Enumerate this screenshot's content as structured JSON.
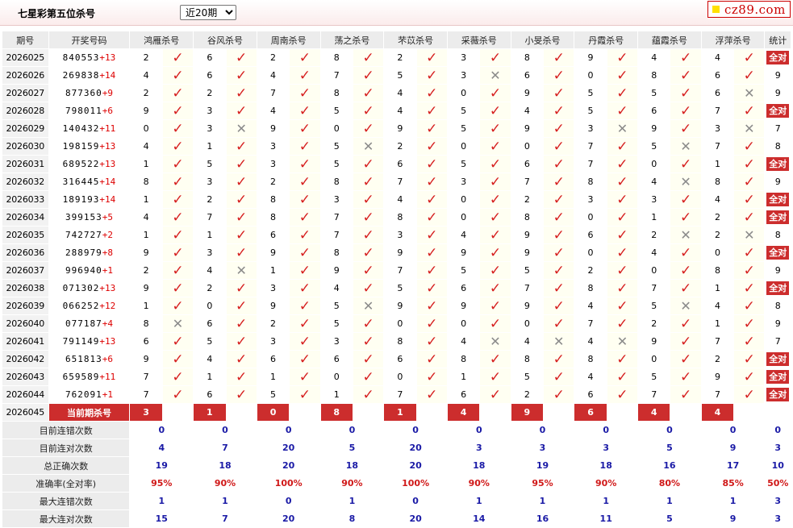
{
  "header": {
    "title": "七星彩第五位杀号",
    "period_options": [
      "近20期"
    ],
    "period_selected": "近20期",
    "logo_text": "cz89.com"
  },
  "table": {
    "col_period": "期号",
    "col_nums": "开奖号码",
    "col_stat": "统计",
    "experts": [
      "鸿雁杀号",
      "谷风杀号",
      "周南杀号",
      "荡之杀号",
      "芣苡杀号",
      "采薇杀号",
      "小旻杀号",
      "丹霞杀号",
      "蕴霞杀号",
      "浮萍杀号"
    ],
    "rows": [
      {
        "period": "2026025",
        "nums": "840553",
        "sum": "+13",
        "kills": [
          "2",
          "6",
          "2",
          "8",
          "2",
          "3",
          "8",
          "9",
          "4",
          "4"
        ],
        "ok": [
          1,
          1,
          1,
          1,
          1,
          1,
          1,
          1,
          1,
          1
        ],
        "stat": "全对"
      },
      {
        "period": "2026026",
        "nums": "269838",
        "sum": "+14",
        "kills": [
          "4",
          "6",
          "4",
          "7",
          "5",
          "3",
          "6",
          "0",
          "8",
          "6"
        ],
        "ok": [
          1,
          1,
          1,
          1,
          1,
          0,
          1,
          1,
          1,
          1
        ],
        "stat": "9"
      },
      {
        "period": "2026027",
        "nums": "877360",
        "sum": "+9",
        "kills": [
          "2",
          "2",
          "7",
          "8",
          "4",
          "0",
          "9",
          "5",
          "5",
          "6"
        ],
        "ok": [
          1,
          1,
          1,
          1,
          1,
          1,
          1,
          1,
          1,
          0
        ],
        "stat": "9"
      },
      {
        "period": "2026028",
        "nums": "798011",
        "sum": "+6",
        "kills": [
          "9",
          "3",
          "4",
          "5",
          "4",
          "5",
          "4",
          "5",
          "6",
          "7"
        ],
        "ok": [
          1,
          1,
          1,
          1,
          1,
          1,
          1,
          1,
          1,
          1
        ],
        "stat": "全对"
      },
      {
        "period": "2026029",
        "nums": "140432",
        "sum": "+11",
        "kills": [
          "0",
          "3",
          "9",
          "0",
          "9",
          "5",
          "9",
          "3",
          "9",
          "3"
        ],
        "ok": [
          1,
          0,
          1,
          1,
          1,
          1,
          1,
          0,
          1,
          0
        ],
        "stat": "7"
      },
      {
        "period": "2026030",
        "nums": "198159",
        "sum": "+13",
        "kills": [
          "4",
          "1",
          "3",
          "5",
          "2",
          "0",
          "0",
          "7",
          "5",
          "7"
        ],
        "ok": [
          1,
          1,
          1,
          0,
          1,
          1,
          1,
          1,
          0,
          1
        ],
        "stat": "8"
      },
      {
        "period": "2026031",
        "nums": "689522",
        "sum": "+13",
        "kills": [
          "1",
          "5",
          "3",
          "5",
          "6",
          "5",
          "6",
          "7",
          "0",
          "1"
        ],
        "ok": [
          1,
          1,
          1,
          1,
          1,
          1,
          1,
          1,
          1,
          1
        ],
        "stat": "全对"
      },
      {
        "period": "2026032",
        "nums": "316445",
        "sum": "+14",
        "kills": [
          "8",
          "3",
          "2",
          "8",
          "7",
          "3",
          "7",
          "8",
          "4",
          "8"
        ],
        "ok": [
          1,
          1,
          1,
          1,
          1,
          1,
          1,
          1,
          0,
          1
        ],
        "stat": "9"
      },
      {
        "period": "2026033",
        "nums": "189193",
        "sum": "+14",
        "kills": [
          "1",
          "2",
          "8",
          "3",
          "4",
          "0",
          "2",
          "3",
          "3",
          "4"
        ],
        "ok": [
          1,
          1,
          1,
          1,
          1,
          1,
          1,
          1,
          1,
          1
        ],
        "stat": "全对"
      },
      {
        "period": "2026034",
        "nums": "399153",
        "sum": "+5",
        "kills": [
          "4",
          "7",
          "8",
          "7",
          "8",
          "0",
          "8",
          "0",
          "1",
          "2"
        ],
        "ok": [
          1,
          1,
          1,
          1,
          1,
          1,
          1,
          1,
          1,
          1
        ],
        "stat": "全对"
      },
      {
        "period": "2026035",
        "nums": "742727",
        "sum": "+2",
        "kills": [
          "1",
          "1",
          "6",
          "7",
          "3",
          "4",
          "9",
          "6",
          "2",
          "2"
        ],
        "ok": [
          1,
          1,
          1,
          1,
          1,
          1,
          1,
          1,
          0,
          0
        ],
        "stat": "8"
      },
      {
        "period": "2026036",
        "nums": "288979",
        "sum": "+8",
        "kills": [
          "9",
          "3",
          "9",
          "8",
          "9",
          "9",
          "9",
          "0",
          "4",
          "0"
        ],
        "ok": [
          1,
          1,
          1,
          1,
          1,
          1,
          1,
          1,
          1,
          1
        ],
        "stat": "全对"
      },
      {
        "period": "2026037",
        "nums": "996940",
        "sum": "+1",
        "kills": [
          "2",
          "4",
          "1",
          "9",
          "7",
          "5",
          "5",
          "2",
          "0",
          "8"
        ],
        "ok": [
          1,
          0,
          1,
          1,
          1,
          1,
          1,
          1,
          1,
          1
        ],
        "stat": "9"
      },
      {
        "period": "2026038",
        "nums": "071302",
        "sum": "+13",
        "kills": [
          "9",
          "2",
          "3",
          "4",
          "5",
          "6",
          "7",
          "8",
          "7",
          "1"
        ],
        "ok": [
          1,
          1,
          1,
          1,
          1,
          1,
          1,
          1,
          1,
          1
        ],
        "stat": "全对"
      },
      {
        "period": "2026039",
        "nums": "066252",
        "sum": "+12",
        "kills": [
          "1",
          "0",
          "9",
          "5",
          "9",
          "9",
          "9",
          "4",
          "5",
          "4"
        ],
        "ok": [
          1,
          1,
          1,
          0,
          1,
          1,
          1,
          1,
          0,
          1
        ],
        "stat": "8"
      },
      {
        "period": "2026040",
        "nums": "077187",
        "sum": "+4",
        "kills": [
          "8",
          "6",
          "2",
          "5",
          "0",
          "0",
          "0",
          "7",
          "2",
          "1"
        ],
        "ok": [
          0,
          1,
          1,
          1,
          1,
          1,
          1,
          1,
          1,
          1
        ],
        "stat": "9"
      },
      {
        "period": "2026041",
        "nums": "791149",
        "sum": "+13",
        "kills": [
          "6",
          "5",
          "3",
          "3",
          "8",
          "4",
          "4",
          "4",
          "9",
          "7"
        ],
        "ok": [
          1,
          1,
          1,
          1,
          1,
          0,
          0,
          0,
          1,
          1
        ],
        "stat": "7"
      },
      {
        "period": "2026042",
        "nums": "651813",
        "sum": "+6",
        "kills": [
          "9",
          "4",
          "6",
          "6",
          "6",
          "8",
          "8",
          "8",
          "0",
          "2"
        ],
        "ok": [
          1,
          1,
          1,
          1,
          1,
          1,
          1,
          1,
          1,
          1
        ],
        "stat": "全对"
      },
      {
        "period": "2026043",
        "nums": "659589",
        "sum": "+11",
        "kills": [
          "7",
          "1",
          "1",
          "0",
          "0",
          "1",
          "5",
          "4",
          "5",
          "9"
        ],
        "ok": [
          1,
          1,
          1,
          1,
          1,
          1,
          1,
          1,
          1,
          1
        ],
        "stat": "全对"
      },
      {
        "period": "2026044",
        "nums": "762091",
        "sum": "+1",
        "kills": [
          "7",
          "6",
          "5",
          "1",
          "7",
          "6",
          "2",
          "6",
          "7",
          "7"
        ],
        "ok": [
          1,
          1,
          1,
          1,
          1,
          1,
          1,
          1,
          1,
          1
        ],
        "stat": "全对"
      }
    ],
    "current": {
      "period": "2026045",
      "label": "当前期杀号",
      "kills": [
        "3",
        "1",
        "0",
        "8",
        "1",
        "4",
        "9",
        "6",
        "4",
        "4"
      ]
    },
    "summary": [
      {
        "label": "目前连错次数",
        "values": [
          "0",
          "0",
          "0",
          "0",
          "0",
          "0",
          "0",
          "0",
          "0",
          "0"
        ],
        "total": "0",
        "red": false
      },
      {
        "label": "目前连对次数",
        "values": [
          "4",
          "7",
          "20",
          "5",
          "20",
          "3",
          "3",
          "3",
          "5",
          "9"
        ],
        "total": "3",
        "red": false
      },
      {
        "label": "总正确次数",
        "values": [
          "19",
          "18",
          "20",
          "18",
          "20",
          "18",
          "19",
          "18",
          "16",
          "17"
        ],
        "total": "10",
        "red": false
      },
      {
        "label": "准确率(全对率)",
        "values": [
          "95%",
          "90%",
          "100%",
          "90%",
          "100%",
          "90%",
          "95%",
          "90%",
          "80%",
          "85%"
        ],
        "total": "50%",
        "red": true
      },
      {
        "label": "最大连错次数",
        "values": [
          "1",
          "1",
          "0",
          "1",
          "0",
          "1",
          "1",
          "1",
          "1",
          "1"
        ],
        "total": "3",
        "red": false
      },
      {
        "label": "最大连对次数",
        "values": [
          "15",
          "7",
          "20",
          "8",
          "20",
          "14",
          "16",
          "11",
          "5",
          "9"
        ],
        "total": "3",
        "red": false
      }
    ]
  },
  "icons": {
    "correct": "checkmark-icon",
    "wrong": "cross-icon"
  },
  "colors": {
    "accent_red": "#cc2d2d",
    "summary_blue": "#1a1aa6",
    "check_red": "#d62020",
    "cross_gray": "#8a8a8a"
  }
}
